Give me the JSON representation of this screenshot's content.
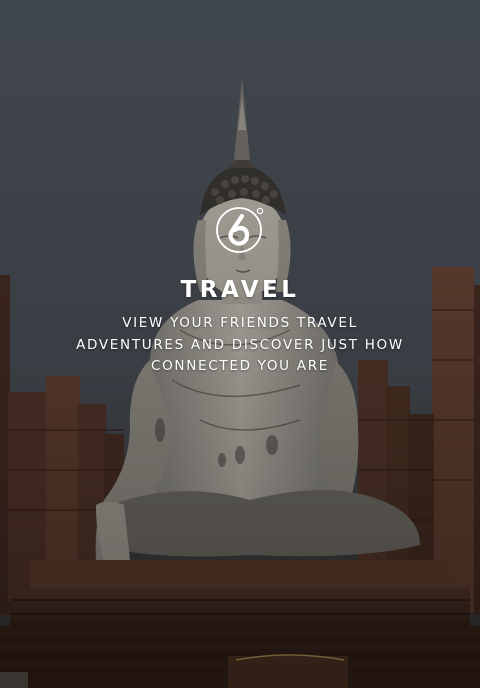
{
  "app": {
    "title": "TRAVEL",
    "description_lines": [
      "VIEW YOUR FRIENDS TRAVEL",
      "ADVENTURES AND DISCOVER JUST HOW",
      "CONNECTED YOU ARE"
    ]
  },
  "logo": {
    "icon": "six-degrees-logo-icon",
    "glyph": "6"
  },
  "background": {
    "icon": "buddha-temple-photo",
    "sky_color": "#4b5158",
    "brick_color": "#5a3a2c"
  }
}
